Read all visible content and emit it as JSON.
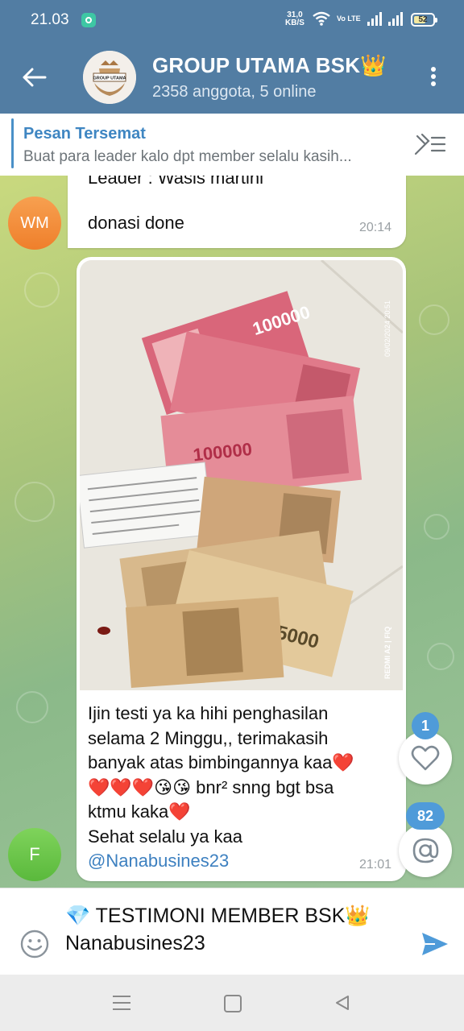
{
  "status_bar": {
    "time": "21.03",
    "speed_value": "31,0",
    "speed_unit": "KB/S",
    "network": "Vo LTE",
    "battery": "52"
  },
  "header": {
    "title": "GROUP UTAMA BSK👑",
    "subtitle": "2358 anggota, 5 online",
    "avatar_text": "GROUP UTAMA"
  },
  "pinned": {
    "title": "Pesan Tersemat",
    "text": "Buat para leader kalo dpt member selalu kasih..."
  },
  "messages": [
    {
      "avatar_initials": "WM",
      "line1": "Leader : Wasis martini",
      "line2": "donasi done",
      "time": "20:14"
    },
    {
      "avatar_initials": "F",
      "photo_stamp_date": "09/02/2024  20:51",
      "photo_stamp_device": "REDMI A2 | FIQ",
      "photo_banknote_label": "100000",
      "text_lines": [
        "Ijin testi ya ka hihi penghasilan",
        "selama 2 Minggu,, terimakasih",
        "banyak atas bimbingannya kaa❤️",
        "❤️❤️❤️😘😘 bnr² snng bgt bsa",
        "ktmu kaka❤️",
        "Sehat selalu ya kaa"
      ],
      "mention": "@Nanabusines23",
      "time": "21:01"
    }
  ],
  "reactions": {
    "heart_count": "1",
    "mention_count": "82"
  },
  "input": {
    "line1": "💎 TESTIMONI MEMBER BSK👑",
    "line2": "Nanabusines23"
  },
  "colors": {
    "header": "#527da3",
    "accent": "#4f9bd9",
    "link": "#3d80c0"
  }
}
